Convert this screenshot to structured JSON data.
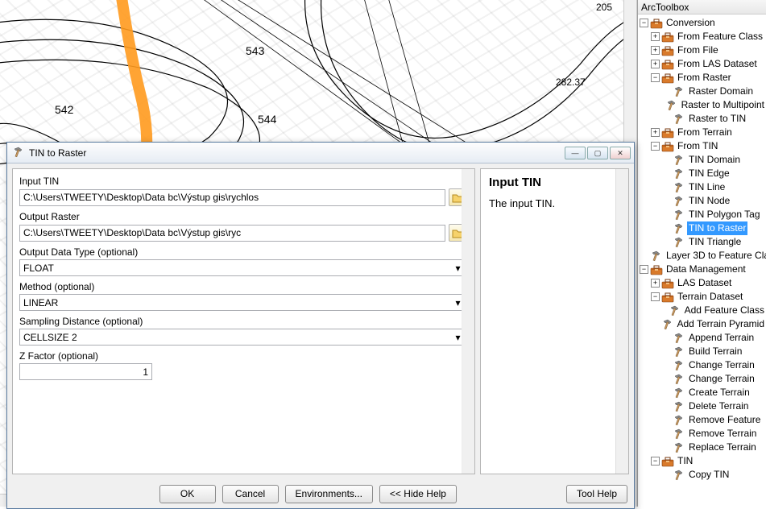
{
  "toolbox": {
    "title": "ArcToolbox",
    "tree": [
      {
        "depth": 0,
        "exp": "-",
        "icon": "toolbox",
        "label": "Conversion"
      },
      {
        "depth": 1,
        "exp": "+",
        "icon": "toolbox",
        "label": "From Feature Class"
      },
      {
        "depth": 1,
        "exp": "+",
        "icon": "toolbox",
        "label": "From File"
      },
      {
        "depth": 1,
        "exp": "+",
        "icon": "toolbox",
        "label": "From LAS Dataset"
      },
      {
        "depth": 1,
        "exp": "-",
        "icon": "toolbox",
        "label": "From Raster"
      },
      {
        "depth": 2,
        "exp": "",
        "icon": "hammer",
        "label": "Raster Domain"
      },
      {
        "depth": 2,
        "exp": "",
        "icon": "hammer",
        "label": "Raster to Multipoint"
      },
      {
        "depth": 2,
        "exp": "",
        "icon": "hammer",
        "label": "Raster to TIN"
      },
      {
        "depth": 1,
        "exp": "+",
        "icon": "toolbox",
        "label": "From Terrain"
      },
      {
        "depth": 1,
        "exp": "-",
        "icon": "toolbox",
        "label": "From TIN"
      },
      {
        "depth": 2,
        "exp": "",
        "icon": "hammer",
        "label": "TIN Domain"
      },
      {
        "depth": 2,
        "exp": "",
        "icon": "hammer",
        "label": "TIN Edge"
      },
      {
        "depth": 2,
        "exp": "",
        "icon": "hammer",
        "label": "TIN Line"
      },
      {
        "depth": 2,
        "exp": "",
        "icon": "hammer",
        "label": "TIN Node"
      },
      {
        "depth": 2,
        "exp": "",
        "icon": "hammer",
        "label": "TIN Polygon Tag"
      },
      {
        "depth": 2,
        "exp": "",
        "icon": "hammer",
        "label": "TIN to Raster",
        "selected": true
      },
      {
        "depth": 2,
        "exp": "",
        "icon": "hammer",
        "label": "TIN Triangle"
      },
      {
        "depth": 1,
        "exp": "",
        "icon": "hammer",
        "label": "Layer 3D to Feature Class"
      },
      {
        "depth": 0,
        "exp": "-",
        "icon": "toolbox",
        "label": "Data Management"
      },
      {
        "depth": 1,
        "exp": "+",
        "icon": "toolbox",
        "label": "LAS Dataset"
      },
      {
        "depth": 1,
        "exp": "-",
        "icon": "toolbox",
        "label": "Terrain Dataset"
      },
      {
        "depth": 2,
        "exp": "",
        "icon": "hammer",
        "label": "Add Feature Class"
      },
      {
        "depth": 2,
        "exp": "",
        "icon": "hammer",
        "label": "Add Terrain Pyramid"
      },
      {
        "depth": 2,
        "exp": "",
        "icon": "hammer",
        "label": "Append Terrain"
      },
      {
        "depth": 2,
        "exp": "",
        "icon": "hammer",
        "label": "Build Terrain"
      },
      {
        "depth": 2,
        "exp": "",
        "icon": "hammer",
        "label": "Change Terrain"
      },
      {
        "depth": 2,
        "exp": "",
        "icon": "hammer",
        "label": "Change Terrain"
      },
      {
        "depth": 2,
        "exp": "",
        "icon": "hammer",
        "label": "Create Terrain"
      },
      {
        "depth": 2,
        "exp": "",
        "icon": "hammer",
        "label": "Delete Terrain"
      },
      {
        "depth": 2,
        "exp": "",
        "icon": "hammer",
        "label": "Remove Feature"
      },
      {
        "depth": 2,
        "exp": "",
        "icon": "hammer",
        "label": "Remove Terrain"
      },
      {
        "depth": 2,
        "exp": "",
        "icon": "hammer",
        "label": "Replace Terrain"
      },
      {
        "depth": 1,
        "exp": "-",
        "icon": "toolbox",
        "label": "TIN"
      },
      {
        "depth": 2,
        "exp": "",
        "icon": "hammer",
        "label": "Copy TIN"
      }
    ]
  },
  "map": {
    "labels": [
      "542",
      "543",
      "544",
      "282.37",
      "205"
    ]
  },
  "dialog": {
    "title": "TIN to Raster",
    "form": {
      "input_tin_label": "Input TIN",
      "input_tin_value": "C:\\Users\\TWEETY\\Desktop\\Data bc\\Výstup gis\\rychlos",
      "output_raster_label": "Output Raster",
      "output_raster_value": "C:\\Users\\TWEETY\\Desktop\\Data bc\\Výstup gis\\ryc",
      "output_type_label": "Output Data Type (optional)",
      "output_type_value": "FLOAT",
      "method_label": "Method (optional)",
      "method_value": "LINEAR",
      "sampling_label": "Sampling Distance (optional)",
      "sampling_value": "CELLSIZE 2",
      "zfactor_label": "Z Factor (optional)",
      "zfactor_value": "1"
    },
    "help": {
      "title": "Input TIN",
      "text": "The input TIN."
    },
    "buttons": {
      "ok": "OK",
      "cancel": "Cancel",
      "env": "Environments...",
      "hide": "<< Hide Help",
      "toolhelp": "Tool Help"
    }
  }
}
